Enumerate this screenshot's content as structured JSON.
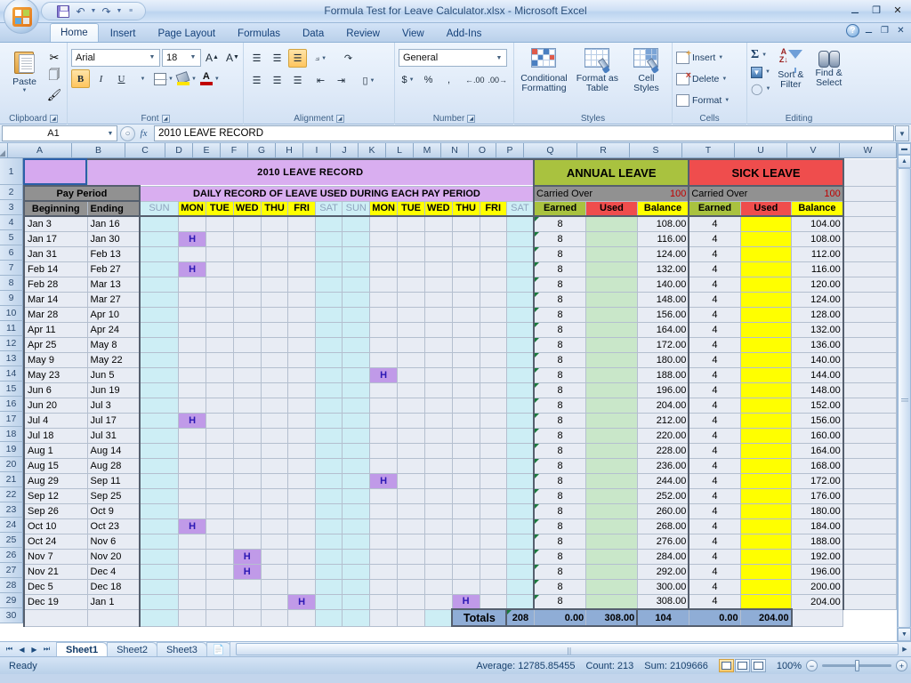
{
  "app": {
    "title": "Formula Test for Leave Calculator.xlsx - Microsoft Excel",
    "office_button": "office-logo",
    "quick_access": [
      "save-icon",
      "undo-icon",
      "redo-icon",
      "customize-qat-icon"
    ],
    "window_controls": [
      "minimize",
      "restore",
      "close"
    ],
    "ribbon_window_controls": [
      "help",
      "minimize-ribbon",
      "restore-window",
      "close-window"
    ]
  },
  "ribbon": {
    "tabs": [
      "Home",
      "Insert",
      "Page Layout",
      "Formulas",
      "Data",
      "Review",
      "View",
      "Add-Ins"
    ],
    "active_tab": "Home",
    "groups": {
      "clipboard": {
        "title": "Clipboard",
        "paste_label": "Paste",
        "items": [
          "cut-icon",
          "copy-icon",
          "format-painter-icon"
        ]
      },
      "font": {
        "title": "Font",
        "font_name": "Arial",
        "font_size": "18",
        "buttons": [
          "grow-font",
          "shrink-font",
          "bold",
          "italic",
          "underline",
          "borders",
          "fill-color",
          "font-color"
        ],
        "bold_active": true
      },
      "alignment": {
        "title": "Alignment",
        "buttons": [
          "align-top",
          "align-middle",
          "align-bottom",
          "orientation",
          "align-left",
          "align-center",
          "align-right",
          "decrease-indent",
          "increase-indent",
          "wrap-text",
          "merge-cells"
        ]
      },
      "number": {
        "title": "Number",
        "format": "General",
        "buttons": [
          "accounting-format",
          "percent-style",
          "comma-style",
          "increase-decimal",
          "decrease-decimal"
        ]
      },
      "styles": {
        "title": "Styles",
        "items": [
          "Conditional Formatting",
          "Format as Table",
          "Cell Styles"
        ]
      },
      "cells": {
        "title": "Cells",
        "items": [
          "Insert",
          "Delete",
          "Format"
        ]
      },
      "editing": {
        "title": "Editing",
        "items": [
          "Sort & Filter",
          "Find & Select"
        ],
        "buttons": [
          "autosum",
          "fill",
          "clear"
        ]
      }
    }
  },
  "formula_bar": {
    "name_box": "A1",
    "formula": "2010 LEAVE RECORD",
    "fx_label": "fx"
  },
  "grid": {
    "column_headers": [
      "A",
      "B",
      "C",
      "D",
      "E",
      "F",
      "G",
      "H",
      "I",
      "J",
      "K",
      "L",
      "M",
      "N",
      "O",
      "P",
      "Q",
      "R",
      "S",
      "T",
      "U",
      "V",
      "W"
    ],
    "row_headers": [
      "1",
      "2",
      "3",
      "4",
      "5",
      "6",
      "7",
      "8",
      "9",
      "10",
      "11",
      "12",
      "13",
      "14",
      "15",
      "16",
      "17",
      "18",
      "19",
      "20",
      "21",
      "22",
      "23",
      "24",
      "25",
      "26",
      "27",
      "28",
      "29",
      "30"
    ],
    "selected_cell": "A1"
  },
  "sheet": {
    "title": "2010 LEAVE RECORD",
    "subtitle": "DAILY RECORD OF LEAVE USED DURING EACH PAY PERIOD",
    "pay_period_label": "Pay Period",
    "col_beginning": "Beginning",
    "col_ending": "Ending",
    "day_headers": [
      "SUN",
      "MON",
      "TUE",
      "WED",
      "THU",
      "FRI",
      "SAT",
      "SUN",
      "MON",
      "TUE",
      "WED",
      "THU",
      "FRI",
      "SAT"
    ],
    "annual_leave": {
      "title": "ANNUAL LEAVE",
      "carried_over_label": "Carried Over",
      "carried_over_value": "100",
      "headers": [
        "Earned",
        "Used",
        "Balance"
      ]
    },
    "sick_leave": {
      "title": "SICK LEAVE",
      "carried_over_label": "Carried Over",
      "carried_over_value": "100",
      "headers": [
        "Earned",
        "Used",
        "Balance"
      ]
    },
    "holiday_marker": "H",
    "totals_label": "Totals",
    "totals": {
      "annual_earned": "208",
      "annual_used": "0.00",
      "annual_balance": "308.00",
      "sick_earned": "104",
      "sick_used": "0.00",
      "sick_balance": "204.00"
    },
    "rows": [
      {
        "row": "4",
        "begin": "Jan 3",
        "end": "Jan 16",
        "holidays": [],
        "a_earned": "8",
        "a_used": "",
        "a_balance": "108.00",
        "s_earned": "4",
        "s_used": "",
        "s_balance": "104.00"
      },
      {
        "row": "5",
        "begin": "Jan 17",
        "end": "Jan 30",
        "holidays": [
          1
        ],
        "a_earned": "8",
        "a_used": "",
        "a_balance": "116.00",
        "s_earned": "4",
        "s_used": "",
        "s_balance": "108.00"
      },
      {
        "row": "6",
        "begin": "Jan 31",
        "end": "Feb 13",
        "holidays": [],
        "a_earned": "8",
        "a_used": "",
        "a_balance": "124.00",
        "s_earned": "4",
        "s_used": "",
        "s_balance": "112.00"
      },
      {
        "row": "7",
        "begin": "Feb 14",
        "end": "Feb 27",
        "holidays": [
          1
        ],
        "a_earned": "8",
        "a_used": "",
        "a_balance": "132.00",
        "s_earned": "4",
        "s_used": "",
        "s_balance": "116.00"
      },
      {
        "row": "8",
        "begin": "Feb 28",
        "end": "Mar 13",
        "holidays": [],
        "a_earned": "8",
        "a_used": "",
        "a_balance": "140.00",
        "s_earned": "4",
        "s_used": "",
        "s_balance": "120.00"
      },
      {
        "row": "9",
        "begin": "Mar 14",
        "end": "Mar 27",
        "holidays": [],
        "a_earned": "8",
        "a_used": "",
        "a_balance": "148.00",
        "s_earned": "4",
        "s_used": "",
        "s_balance": "124.00"
      },
      {
        "row": "10",
        "begin": "Mar 28",
        "end": "Apr 10",
        "holidays": [],
        "a_earned": "8",
        "a_used": "",
        "a_balance": "156.00",
        "s_earned": "4",
        "s_used": "",
        "s_balance": "128.00"
      },
      {
        "row": "11",
        "begin": "Apr 11",
        "end": "Apr 24",
        "holidays": [],
        "a_earned": "8",
        "a_used": "",
        "a_balance": "164.00",
        "s_earned": "4",
        "s_used": "",
        "s_balance": "132.00"
      },
      {
        "row": "12",
        "begin": "Apr 25",
        "end": "May 8",
        "holidays": [],
        "a_earned": "8",
        "a_used": "",
        "a_balance": "172.00",
        "s_earned": "4",
        "s_used": "",
        "s_balance": "136.00"
      },
      {
        "row": "13",
        "begin": "May 9",
        "end": "May 22",
        "holidays": [],
        "a_earned": "8",
        "a_used": "",
        "a_balance": "180.00",
        "s_earned": "4",
        "s_used": "",
        "s_balance": "140.00"
      },
      {
        "row": "14",
        "begin": "May 23",
        "end": "Jun 5",
        "holidays": [
          8
        ],
        "a_earned": "8",
        "a_used": "",
        "a_balance": "188.00",
        "s_earned": "4",
        "s_used": "",
        "s_balance": "144.00"
      },
      {
        "row": "15",
        "begin": "Jun 6",
        "end": "Jun 19",
        "holidays": [],
        "a_earned": "8",
        "a_used": "",
        "a_balance": "196.00",
        "s_earned": "4",
        "s_used": "",
        "s_balance": "148.00"
      },
      {
        "row": "16",
        "begin": "Jun 20",
        "end": "Jul 3",
        "holidays": [],
        "a_earned": "8",
        "a_used": "",
        "a_balance": "204.00",
        "s_earned": "4",
        "s_used": "",
        "s_balance": "152.00"
      },
      {
        "row": "17",
        "begin": "Jul 4",
        "end": "Jul 17",
        "holidays": [
          1
        ],
        "a_earned": "8",
        "a_used": "",
        "a_balance": "212.00",
        "s_earned": "4",
        "s_used": "",
        "s_balance": "156.00"
      },
      {
        "row": "18",
        "begin": "Jul 18",
        "end": "Jul 31",
        "holidays": [],
        "a_earned": "8",
        "a_used": "",
        "a_balance": "220.00",
        "s_earned": "4",
        "s_used": "",
        "s_balance": "160.00"
      },
      {
        "row": "19",
        "begin": "Aug 1",
        "end": "Aug 14",
        "holidays": [],
        "a_earned": "8",
        "a_used": "",
        "a_balance": "228.00",
        "s_earned": "4",
        "s_used": "",
        "s_balance": "164.00"
      },
      {
        "row": "20",
        "begin": "Aug 15",
        "end": "Aug 28",
        "holidays": [],
        "a_earned": "8",
        "a_used": "",
        "a_balance": "236.00",
        "s_earned": "4",
        "s_used": "",
        "s_balance": "168.00"
      },
      {
        "row": "21",
        "begin": "Aug 29",
        "end": "Sep 11",
        "holidays": [
          8
        ],
        "a_earned": "8",
        "a_used": "",
        "a_balance": "244.00",
        "s_earned": "4",
        "s_used": "",
        "s_balance": "172.00"
      },
      {
        "row": "22",
        "begin": "Sep 12",
        "end": "Sep 25",
        "holidays": [],
        "a_earned": "8",
        "a_used": "",
        "a_balance": "252.00",
        "s_earned": "4",
        "s_used": "",
        "s_balance": "176.00"
      },
      {
        "row": "23",
        "begin": "Sep 26",
        "end": "Oct 9",
        "holidays": [],
        "a_earned": "8",
        "a_used": "",
        "a_balance": "260.00",
        "s_earned": "4",
        "s_used": "",
        "s_balance": "180.00"
      },
      {
        "row": "24",
        "begin": "Oct 10",
        "end": "Oct 23",
        "holidays": [
          1
        ],
        "a_earned": "8",
        "a_used": "",
        "a_balance": "268.00",
        "s_earned": "4",
        "s_used": "",
        "s_balance": "184.00"
      },
      {
        "row": "25",
        "begin": "Oct 24",
        "end": "Nov 6",
        "holidays": [],
        "a_earned": "8",
        "a_used": "",
        "a_balance": "276.00",
        "s_earned": "4",
        "s_used": "",
        "s_balance": "188.00"
      },
      {
        "row": "26",
        "begin": "Nov 7",
        "end": "Nov 20",
        "holidays": [
          3
        ],
        "a_earned": "8",
        "a_used": "",
        "a_balance": "284.00",
        "s_earned": "4",
        "s_used": "",
        "s_balance": "192.00"
      },
      {
        "row": "27",
        "begin": "Nov 21",
        "end": "Dec 4",
        "holidays": [
          3
        ],
        "a_earned": "8",
        "a_used": "",
        "a_balance": "292.00",
        "s_earned": "4",
        "s_used": "",
        "s_balance": "196.00"
      },
      {
        "row": "28",
        "begin": "Dec 5",
        "end": "Dec 18",
        "holidays": [],
        "a_earned": "8",
        "a_used": "",
        "a_balance": "300.00",
        "s_earned": "4",
        "s_used": "",
        "s_balance": "200.00"
      },
      {
        "row": "29",
        "begin": "Dec 19",
        "end": "Jan 1",
        "holidays": [
          5,
          11
        ],
        "a_earned": "8",
        "a_used": "",
        "a_balance": "308.00",
        "s_earned": "4",
        "s_used": "",
        "s_balance": "204.00"
      }
    ]
  },
  "sheet_tabs": {
    "tabs": [
      "Sheet1",
      "Sheet2",
      "Sheet3"
    ],
    "active": "Sheet1",
    "new_sheet_icon": "insert-worksheet-icon",
    "nav": [
      "first-sheet",
      "prev-sheet",
      "next-sheet",
      "last-sheet"
    ]
  },
  "status_bar": {
    "mode": "Ready",
    "average": "Average: 12785.85455",
    "count": "Count: 213",
    "sum": "Sum: 2109666",
    "views": [
      "normal-view",
      "page-layout-view",
      "page-break-preview"
    ],
    "active_view": "normal-view",
    "zoom": "100%"
  },
  "colors": {
    "lavender": "#d9aef0",
    "annual_green": "#a9c23f",
    "sick_red": "#ef4d4d",
    "yellow": "#ffff00",
    "gray_band": "#919191",
    "holiday": "#c09ae8",
    "weekend_blue": "#cdeef5",
    "totals_blue": "#8fadd6",
    "carried_value_red": "#c00000"
  }
}
